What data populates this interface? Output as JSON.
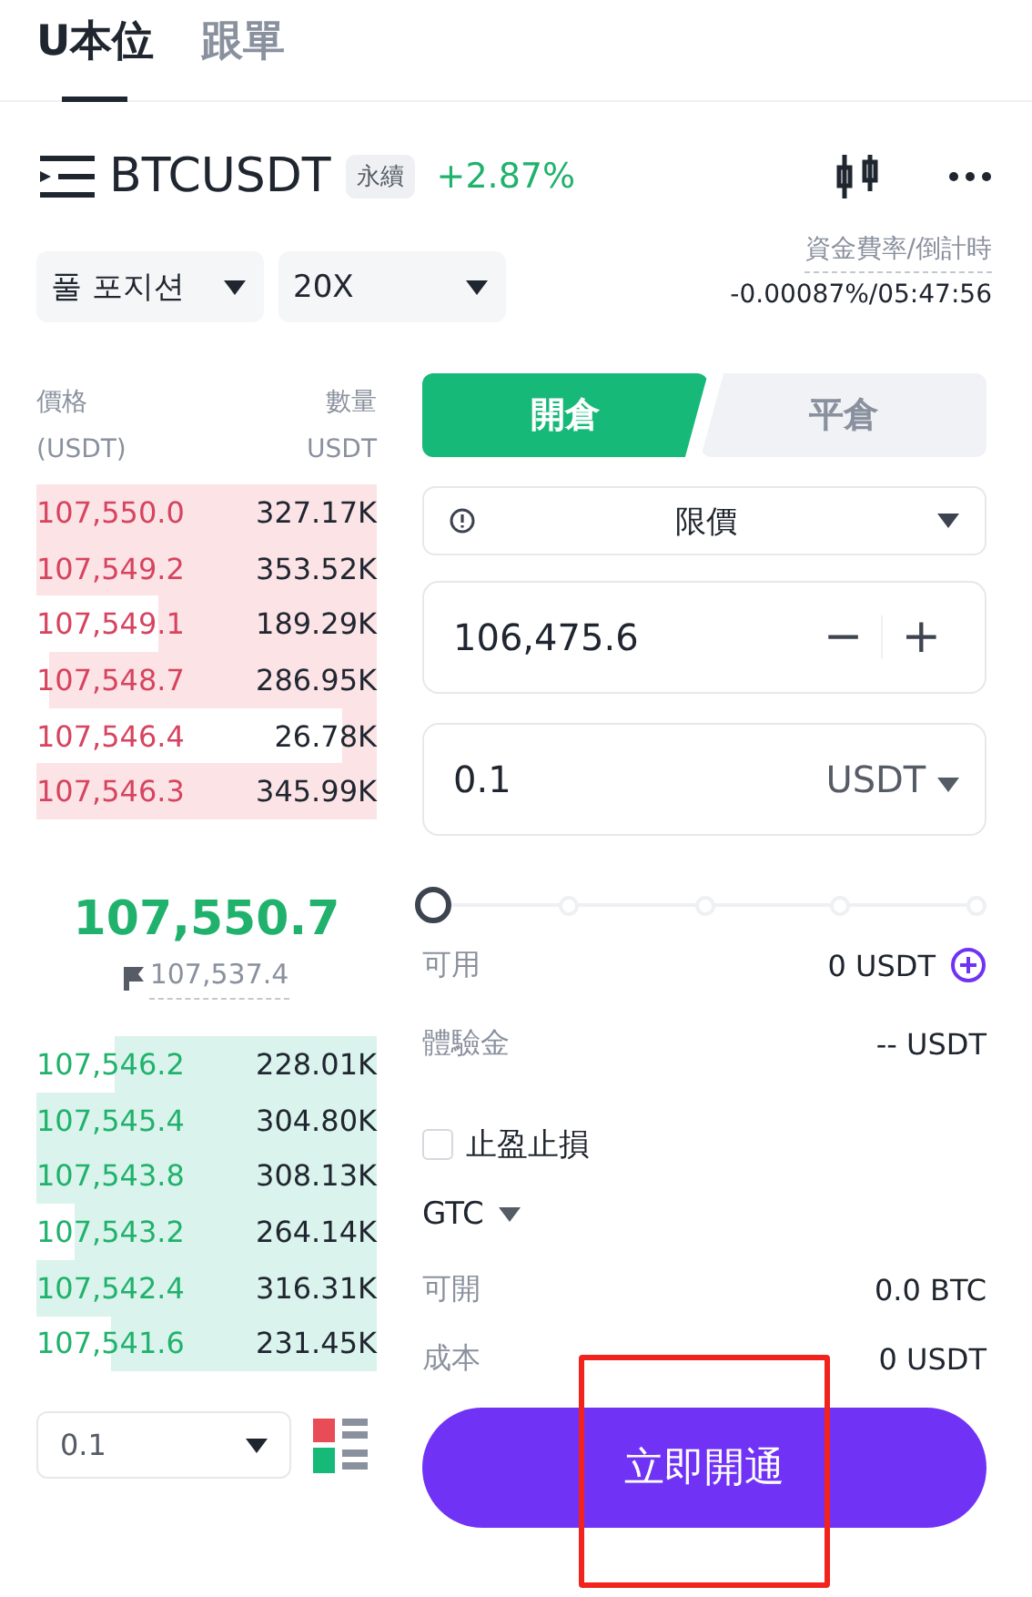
{
  "top_tabs": [
    {
      "label": "U本位",
      "selected": true
    },
    {
      "label": "跟單",
      "selected": false
    }
  ],
  "symbol": {
    "name": "BTCUSDT",
    "badge": "永續",
    "change": "+2.87%"
  },
  "selectors": [
    {
      "value": "풀 포지션"
    },
    {
      "value": "20X"
    }
  ],
  "funding": {
    "label": "資金費率/倒計時",
    "value": "-0.00087%/05:47:56"
  },
  "orderbook": {
    "price_header": "價格",
    "price_unit": "(USDT)",
    "qty_header": "數量",
    "qty_unit": "USDT",
    "asks": [
      {
        "price": "107,550.0",
        "qty": "327.17K",
        "level": 1
      },
      {
        "price": "107,549.2",
        "qty": "353.52K",
        "level": 1
      },
      {
        "price": "107,549.1",
        "qty": "189.29K",
        "level": 0.64
      },
      {
        "price": "107,548.7",
        "qty": "286.95K",
        "level": 0.96
      },
      {
        "price": "107,546.4",
        "qty": "26.78K",
        "level": 0.1
      },
      {
        "price": "107,546.3",
        "qty": "345.99K",
        "level": 1
      }
    ],
    "last_price": "107,550.7",
    "mark_price": "107,537.4",
    "bids": [
      {
        "price": "107,546.2",
        "qty": "228.01K",
        "level": 0.77
      },
      {
        "price": "107,545.4",
        "qty": "304.80K",
        "level": 1
      },
      {
        "price": "107,543.8",
        "qty": "308.13K",
        "level": 1
      },
      {
        "price": "107,543.2",
        "qty": "264.14K",
        "level": 0.89
      },
      {
        "price": "107,542.4",
        "qty": "316.31K",
        "level": 1
      },
      {
        "price": "107,541.6",
        "qty": "231.45K",
        "level": 0.78
      }
    ],
    "precision": "0.1"
  },
  "side_tabs": [
    {
      "label": "開倉",
      "selected": true
    },
    {
      "label": "平倉",
      "selected": false
    }
  ],
  "order_type": "限價",
  "price_value": "106,475.6",
  "minus": "−",
  "plus": "+",
  "amount": {
    "value": "0.1",
    "unit": "USDT"
  },
  "slider": {
    "level": 0
  },
  "info_rows": [
    {
      "label": "可用",
      "value": "0 USDT",
      "add": true
    },
    {
      "label": "體驗金",
      "value": "-- USDT",
      "add": false
    }
  ],
  "tp_sl": {
    "label": "止盈止損",
    "checked": false
  },
  "tif": "GTC",
  "summary_rows": [
    {
      "label": "可開",
      "value": "0.0 BTC"
    },
    {
      "label": "成本",
      "value": "0 USDT"
    }
  ],
  "action_button": "立即開通"
}
